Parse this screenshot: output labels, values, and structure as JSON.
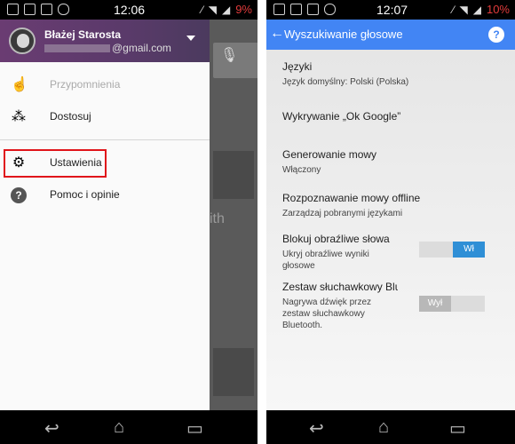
{
  "left_screen": {
    "status": {
      "time": "12:06",
      "battery": "9%"
    },
    "account": {
      "name": "Błażej Starosta",
      "email": "@gmail.com"
    },
    "menu": [
      {
        "icon": "hand-icon",
        "label": "Przypomnienia",
        "disabled": true
      },
      {
        "icon": "magic-wand-icon",
        "label": "Dostosuj"
      },
      {
        "icon": "gear-icon",
        "label": "Ustawienia",
        "highlighted": true
      },
      {
        "icon": "help-icon",
        "label": "Pomoc i opinie"
      }
    ],
    "background_text": "ith"
  },
  "right_screen": {
    "status": {
      "time": "12:07",
      "battery": "10%"
    },
    "title": "Wyszukiwanie głosowe",
    "settings": [
      {
        "title": "Języki",
        "subtitle": "Język domyślny: Polski (Polska)"
      },
      {
        "title": "Wykrywanie „Ok Google”",
        "subtitle": ""
      },
      {
        "title": "Generowanie mowy",
        "subtitle": "Włączony"
      },
      {
        "title": "Rozpoznawanie mowy offline",
        "subtitle": "Zarządzaj pobranymi językami"
      },
      {
        "title": "Blokuj obraźliwe słowa",
        "subtitle_lines": [
          "Ukryj obraźliwe wyniki",
          "głosowe"
        ],
        "toggle": "Wł",
        "toggle_on": true
      },
      {
        "title": "Zestaw słuchawkowy Bluetooth",
        "subtitle_lines": [
          "Nagrywa dźwięk przez",
          "zestaw słuchawkowy",
          "Bluetooth."
        ],
        "toggle": "Wył",
        "toggle_on": false
      }
    ]
  },
  "colors": {
    "accent": "#4285f4",
    "toggle_on": "#2f8fd6",
    "highlight": "#e0141a",
    "battery_low": "#e23b3b"
  }
}
